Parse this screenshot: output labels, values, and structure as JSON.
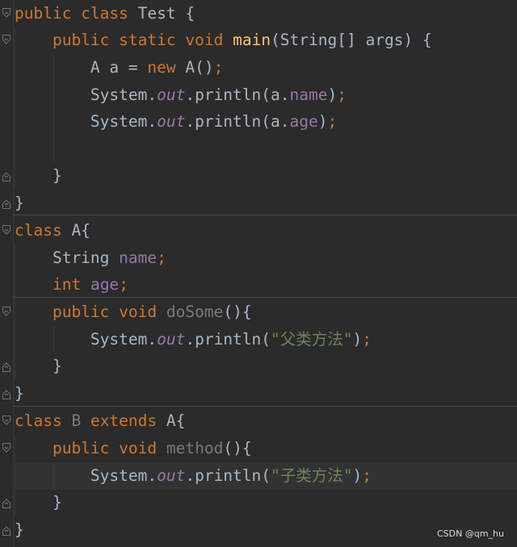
{
  "editor": {
    "lines": [
      {
        "tokens": [
          [
            "public",
            "kw"
          ],
          [
            " ",
            "plain"
          ],
          [
            "class",
            "kw"
          ],
          [
            " Test {",
            "plain"
          ]
        ]
      },
      {
        "tokens": [
          [
            "    ",
            "plain"
          ],
          [
            "public",
            "kw"
          ],
          [
            " ",
            "plain"
          ],
          [
            "static",
            "kw"
          ],
          [
            " ",
            "plain"
          ],
          [
            "void",
            "kw"
          ],
          [
            " ",
            "plain"
          ],
          [
            "main",
            "fn"
          ],
          [
            "(String[] args) {",
            "plain"
          ]
        ]
      },
      {
        "tokens": [
          [
            "        A a = ",
            "plain"
          ],
          [
            "new",
            "kw"
          ],
          [
            " A()",
            "plain"
          ],
          [
            ";",
            "semi"
          ]
        ]
      },
      {
        "tokens": [
          [
            "        System.",
            "plain"
          ],
          [
            "out",
            "static-field"
          ],
          [
            ".println(a.",
            "plain"
          ],
          [
            "name",
            "field"
          ],
          [
            ")",
            "plain"
          ],
          [
            ";",
            "semi"
          ]
        ]
      },
      {
        "tokens": [
          [
            "        System.",
            "plain"
          ],
          [
            "out",
            "static-field"
          ],
          [
            ".println(a.",
            "plain"
          ],
          [
            "age",
            "field"
          ],
          [
            ")",
            "plain"
          ],
          [
            ";",
            "semi"
          ]
        ]
      },
      {
        "tokens": []
      },
      {
        "tokens": [
          [
            "    }",
            "plain"
          ]
        ]
      },
      {
        "tokens": [
          [
            "}",
            "plain"
          ]
        ]
      },
      {
        "tokens": [
          [
            "class",
            "kw"
          ],
          [
            " A{",
            "plain"
          ]
        ]
      },
      {
        "tokens": [
          [
            "    String ",
            "plain"
          ],
          [
            "name",
            "field"
          ],
          [
            ";",
            "semi"
          ]
        ]
      },
      {
        "tokens": [
          [
            "    ",
            "plain"
          ],
          [
            "int",
            "kw"
          ],
          [
            " ",
            "plain"
          ],
          [
            "age",
            "field"
          ],
          [
            ";",
            "semi"
          ]
        ]
      },
      {
        "tokens": [
          [
            "    ",
            "plain"
          ],
          [
            "public",
            "kw"
          ],
          [
            " ",
            "plain"
          ],
          [
            "void",
            "kw"
          ],
          [
            " ",
            "plain"
          ],
          [
            "doSome",
            "unused"
          ],
          [
            "(){",
            "plain"
          ]
        ]
      },
      {
        "tokens": [
          [
            "        System.",
            "plain"
          ],
          [
            "out",
            "static-field"
          ],
          [
            ".println(",
            "plain"
          ],
          [
            "\"父类方法\"",
            "str"
          ],
          [
            ")",
            "plain"
          ],
          [
            ";",
            "semi"
          ]
        ]
      },
      {
        "tokens": [
          [
            "    }",
            "plain"
          ]
        ]
      },
      {
        "tokens": [
          [
            "}",
            "plain"
          ]
        ]
      },
      {
        "tokens": [
          [
            "class",
            "kw"
          ],
          [
            " ",
            "plain"
          ],
          [
            "B",
            "unused"
          ],
          [
            " ",
            "plain"
          ],
          [
            "extends",
            "kw"
          ],
          [
            " A{",
            "plain"
          ]
        ]
      },
      {
        "tokens": [
          [
            "    ",
            "plain"
          ],
          [
            "public",
            "kw"
          ],
          [
            " ",
            "plain"
          ],
          [
            "void",
            "kw"
          ],
          [
            " ",
            "plain"
          ],
          [
            "method",
            "unused"
          ],
          [
            "(){",
            "plain"
          ]
        ]
      },
      {
        "tokens": [
          [
            "        System.",
            "plain"
          ],
          [
            "out",
            "static-field"
          ],
          [
            ".println(",
            "plain"
          ],
          [
            "\"子类方法\"",
            "str"
          ],
          [
            ")",
            "plain"
          ],
          [
            ";",
            "semi"
          ]
        ]
      },
      {
        "tokens": [
          [
            "    }",
            "plain"
          ]
        ]
      },
      {
        "tokens": [
          [
            "}",
            "plain"
          ]
        ]
      }
    ],
    "current_line_index": 17
  },
  "watermark": {
    "text": "CSDN @qm_hu"
  },
  "colors": {
    "background": "#2b2b2b",
    "keyword": "#cc7832",
    "function": "#ffc66d",
    "field": "#9876aa",
    "string": "#6a8759",
    "plain": "#a9b7c6",
    "unused": "#7a7a7a"
  }
}
